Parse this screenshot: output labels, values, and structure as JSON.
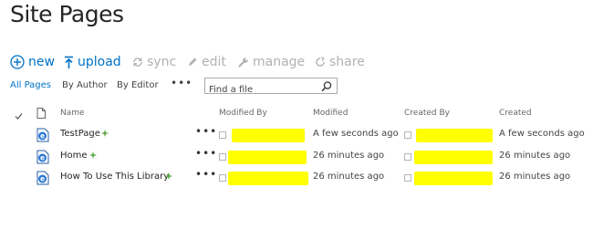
{
  "page_title": "Site Pages",
  "toolbar": {
    "new_label": "new",
    "upload_label": "upload",
    "sync_label": "sync",
    "edit_label": "edit",
    "manage_label": "manage",
    "share_label": "share"
  },
  "views": {
    "all_pages": "All Pages",
    "by_author": "By Author",
    "by_editor": "By Editor",
    "more": "•••"
  },
  "search": {
    "placeholder": "Find a file"
  },
  "columns": {
    "name": "Name",
    "modified_by": "Modified By",
    "modified": "Modified",
    "created_by": "Created By",
    "created": "Created"
  },
  "rows": [
    {
      "name": "TestPage",
      "modified": "A few seconds ago",
      "created": "A few seconds ago",
      "ellipsis": "•••"
    },
    {
      "name": "Home",
      "modified": "26 minutes ago",
      "created": "26 minutes ago",
      "ellipsis": "•••"
    },
    {
      "name": "How To Use This Library",
      "modified": "26 minutes ago",
      "created": "26 minutes ago",
      "ellipsis": "•••"
    }
  ],
  "colors": {
    "accent": "#0072c6",
    "disabled": "#b1b1b1",
    "redaction": "#ffff00",
    "new_badge": "#5ea84a"
  },
  "icons": {
    "new": "plus-circle-icon",
    "upload": "upload-arrow-icon",
    "sync": "sync-icon",
    "edit": "pencil-icon",
    "manage": "wrench-icon",
    "share": "share-icon",
    "search": "magnifier-icon",
    "file": "web-page-icon"
  }
}
